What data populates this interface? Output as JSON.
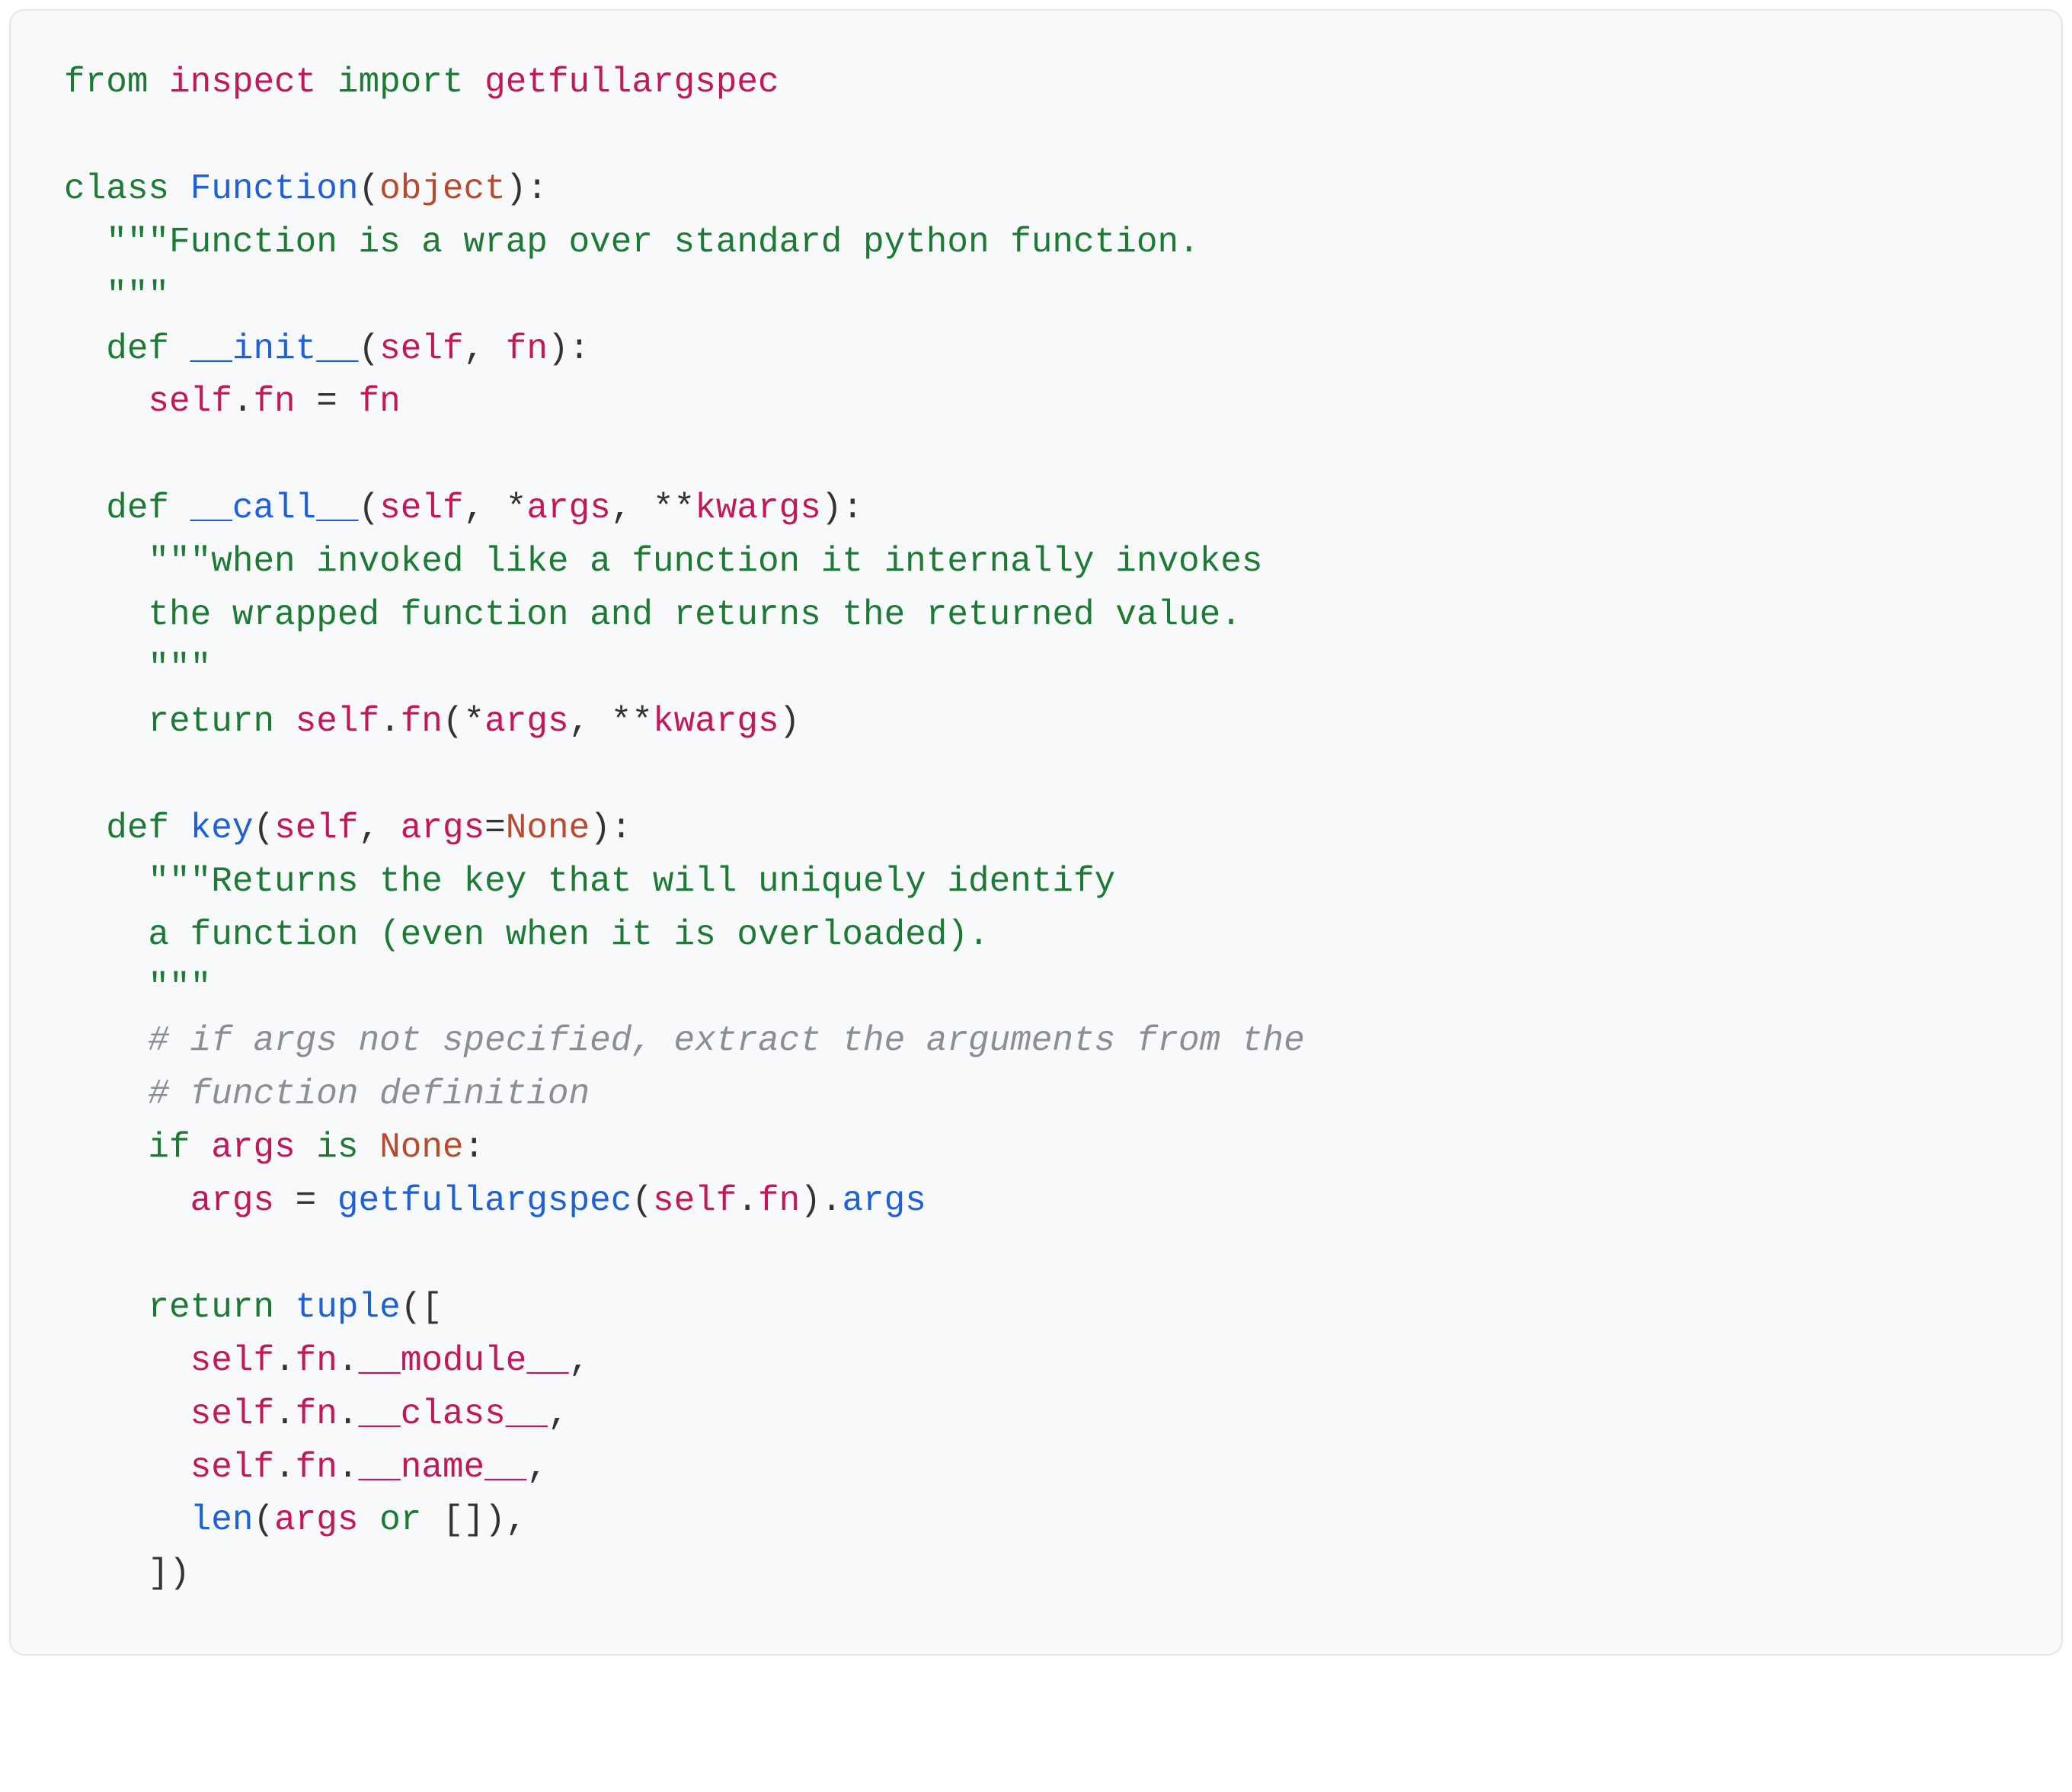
{
  "code": {
    "l1": {
      "from": "from",
      "sp": " ",
      "inspect": "inspect",
      "sp2": " ",
      "import": "import",
      "sp3": " ",
      "getfullargspec": "getfullargspec"
    },
    "l2": "",
    "l3": {
      "class": "class",
      "sp": " ",
      "Function": "Function",
      "lp": "(",
      "object": "object",
      "rp": "):"
    },
    "l4": {
      "indent": "  ",
      "doc": "\"\"\"Function is a wrap over standard python function."
    },
    "l5": {
      "indent": "  ",
      "doc": "\"\"\""
    },
    "l6": {
      "indent": "  ",
      "def": "def",
      "sp": " ",
      "name": "__init__",
      "lp": "(",
      "self": "self",
      "c": ", ",
      "fn": "fn",
      "rp": "):"
    },
    "l7": {
      "indent": "    ",
      "self": "self",
      "dot": ".",
      "fn": "fn",
      "sp": " ",
      "eq": "=",
      "sp2": " ",
      "fn2": "fn"
    },
    "l8": "",
    "l9": {
      "indent": "  ",
      "def": "def",
      "sp": " ",
      "name": "__call__",
      "lp": "(",
      "self": "self",
      "c": ", ",
      "star": "*",
      "args": "args",
      "c2": ", ",
      "dstar": "**",
      "kwargs": "kwargs",
      "rp": "):"
    },
    "l10": {
      "indent": "    ",
      "doc": "\"\"\"when invoked like a function it internally invokes"
    },
    "l11": {
      "indent": "    ",
      "doc": "the wrapped function and returns the returned value."
    },
    "l12": {
      "indent": "    ",
      "doc": "\"\"\""
    },
    "l13": {
      "indent": "    ",
      "return": "return",
      "sp": " ",
      "self": "self",
      "dot": ".",
      "fn": "fn",
      "lp": "(",
      "star": "*",
      "args": "args",
      "c": ", ",
      "dstar": "**",
      "kwargs": "kwargs",
      "rp": ")"
    },
    "l14": "",
    "l15": {
      "indent": "  ",
      "def": "def",
      "sp": " ",
      "name": "key",
      "lp": "(",
      "self": "self",
      "c": ", ",
      "args": "args",
      "eq": "=",
      "none": "None",
      "rp": "):"
    },
    "l16": {
      "indent": "    ",
      "doc": "\"\"\"Returns the key that will uniquely identify"
    },
    "l17": {
      "indent": "    ",
      "doc": "a function (even when it is overloaded)."
    },
    "l18": {
      "indent": "    ",
      "doc": "\"\"\""
    },
    "l19": {
      "indent": "    ",
      "cmt": "# if args not specified, extract the arguments from the"
    },
    "l20": {
      "indent": "    ",
      "cmt": "# function definition"
    },
    "l21": {
      "indent": "    ",
      "if": "if",
      "sp": " ",
      "args": "args",
      "sp2": " ",
      "is": "is",
      "sp3": " ",
      "none": "None",
      "colon": ":"
    },
    "l22": {
      "indent": "      ",
      "args": "args",
      "sp": " ",
      "eq": "=",
      "sp2": " ",
      "call": "getfullargspec",
      "lp": "(",
      "self": "self",
      "dot": ".",
      "fn": "fn",
      "rp": ").",
      "attr": "args"
    },
    "l23": "",
    "l24": {
      "indent": "    ",
      "return": "return",
      "sp": " ",
      "tuple": "tuple",
      "lp": "(["
    },
    "l25": {
      "indent": "      ",
      "self": "self",
      "dot": ".",
      "fn": "fn",
      "dot2": ".",
      "attr": "__module__",
      "c": ","
    },
    "l26": {
      "indent": "      ",
      "self": "self",
      "dot": ".",
      "fn": "fn",
      "dot2": ".",
      "attr": "__class__",
      "c": ","
    },
    "l27": {
      "indent": "      ",
      "self": "self",
      "dot": ".",
      "fn": "fn",
      "dot2": ".",
      "attr": "__name__",
      "c": ","
    },
    "l28": {
      "indent": "      ",
      "len": "len",
      "lp": "(",
      "args": "args",
      "sp": " ",
      "or": "or",
      "sp2": " ",
      "empty": "[]",
      "rp": "),"
    },
    "l29": {
      "indent": "    ",
      "close": "])"
    }
  }
}
